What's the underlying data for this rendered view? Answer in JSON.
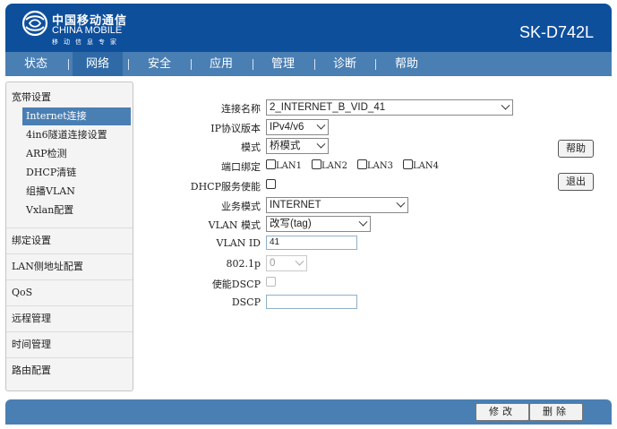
{
  "header": {
    "logo_cn": "中国移动通信",
    "logo_en": "CHINA MOBILE",
    "logo_sub": "移动信息专家",
    "model": "SK-D742L"
  },
  "nav": {
    "items": [
      "状态",
      "网络",
      "安全",
      "应用",
      "管理",
      "诊断",
      "帮助"
    ],
    "active": "网络"
  },
  "sidebar": {
    "section_broadband": "宽带设置",
    "sub_items": [
      "Internet连接",
      "4in6隧道连接设置",
      "ARP检测",
      "DHCP清链",
      "组播VLAN",
      "Vxlan配置"
    ],
    "active_sub": "Internet连接",
    "sections": [
      "绑定设置",
      "LAN侧地址配置",
      "QoS",
      "远程管理",
      "时间管理",
      "路由配置"
    ]
  },
  "form": {
    "connection_name_label": "连接名称",
    "connection_name_value": "2_INTERNET_B_VID_41",
    "ip_version_label": "IP协议版本",
    "ip_version_value": "IPv4/v6",
    "mode_label": "模式",
    "mode_value": "桥模式",
    "port_binding_label": "端口绑定",
    "ports": [
      "LAN1",
      "LAN2",
      "LAN3",
      "LAN4"
    ],
    "dhcp_label": "DHCP服务使能",
    "service_mode_label": "业务模式",
    "service_mode_value": "INTERNET",
    "vlan_mode_label": "VLAN 模式",
    "vlan_mode_value": "改写(tag)",
    "vlan_id_label": "VLAN ID",
    "vlan_id_value": "41",
    "dot1p_label": "802.1p",
    "dot1p_value": "0",
    "enable_dscp_label": "使能DSCP",
    "dscp_label": "DSCP",
    "dscp_value": ""
  },
  "side_buttons": {
    "help": "帮助",
    "logout": "退出"
  },
  "footer": {
    "modify": "修改",
    "delete": "删除"
  },
  "colors": {
    "header_bg": "#0e4f9c",
    "nav_bg": "#4a7fb3",
    "active_nav_bg": "#2f6aa7",
    "active_menu_bg": "#4a7fb3"
  }
}
